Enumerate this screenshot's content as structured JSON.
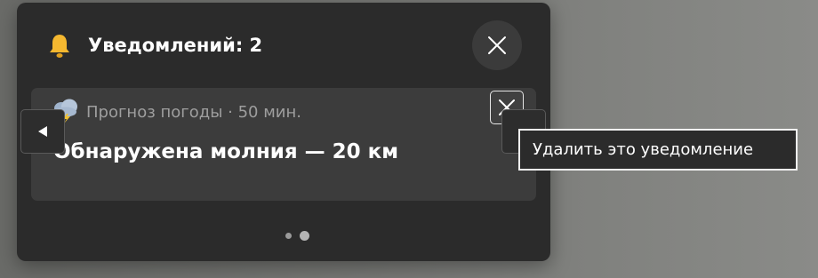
{
  "panel": {
    "title": "Уведомлений: 2",
    "icon": "bell-icon",
    "close_icon": "close-icon"
  },
  "notification": {
    "icon": "weather-cloud-icon",
    "source": "Прогноз погоды · 50 мин.",
    "headline": "Обнаружена молния — 20 км",
    "dismiss_icon": "close-icon"
  },
  "pager": {
    "total": 2,
    "current": 2
  },
  "tooltip": {
    "text": "Удалить это уведомление"
  },
  "colors": {
    "panel_bg": "#2b2b2b",
    "card_bg": "#3c3c3c",
    "bell": "#f5b830"
  }
}
